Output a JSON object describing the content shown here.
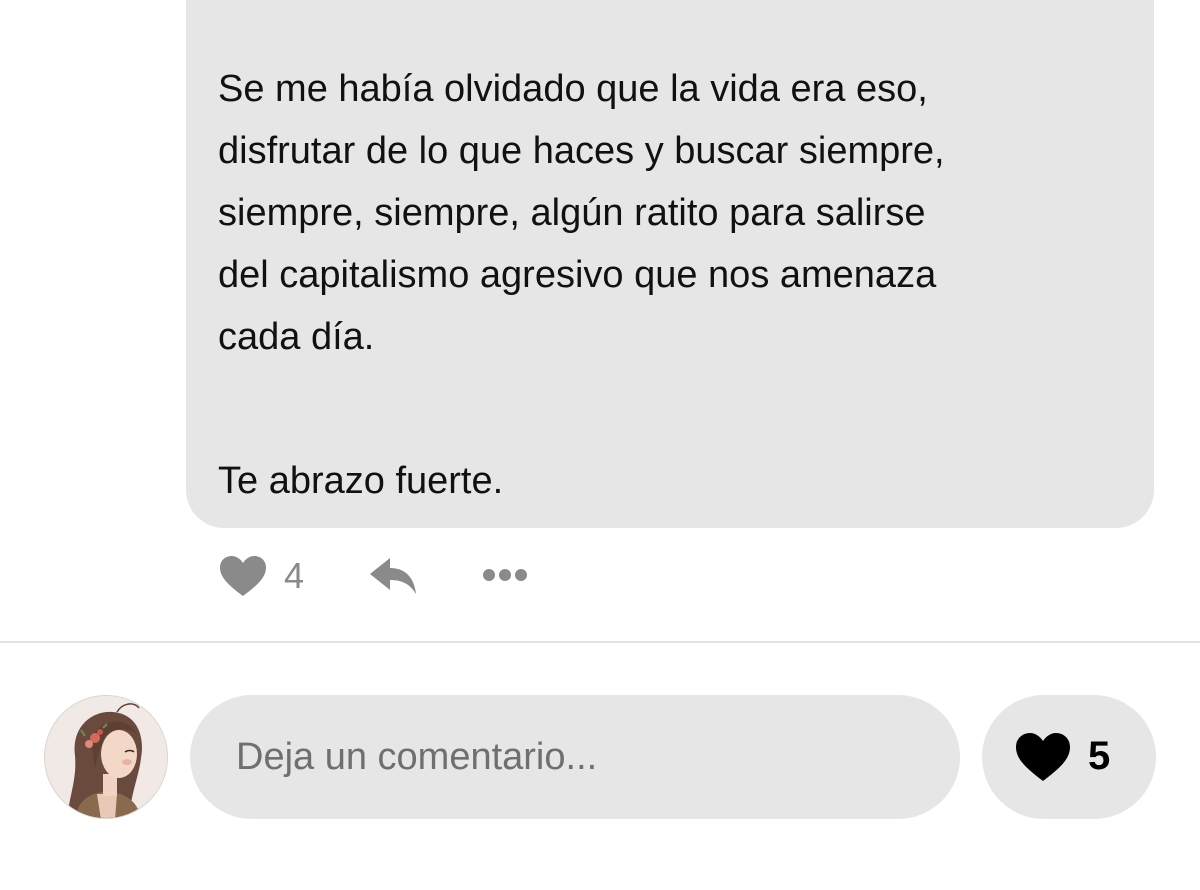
{
  "comment": {
    "lines": [
      "Se me había olvidado que la vida era eso,",
      "disfrutar de lo que haces y buscar siempre,",
      "siempre, siempre, algún ratito para salirse",
      "del capitalismo agresivo que nos amenaza",
      "cada día."
    ],
    "signoff": "Te abrazo fuerte.",
    "like_count": "4",
    "icons": {
      "like": "heart-icon",
      "reply": "reply-icon",
      "more": "more-icon"
    }
  },
  "composer": {
    "avatar_icon": "avatar",
    "placeholder": "Deja un comentario...",
    "like_count": "5",
    "like_icon": "heart-icon"
  },
  "colors": {
    "bubble_bg": "#e6e6e6",
    "text": "#111111",
    "muted_icon": "#8a8a8a",
    "divider": "#e3e3e3"
  }
}
